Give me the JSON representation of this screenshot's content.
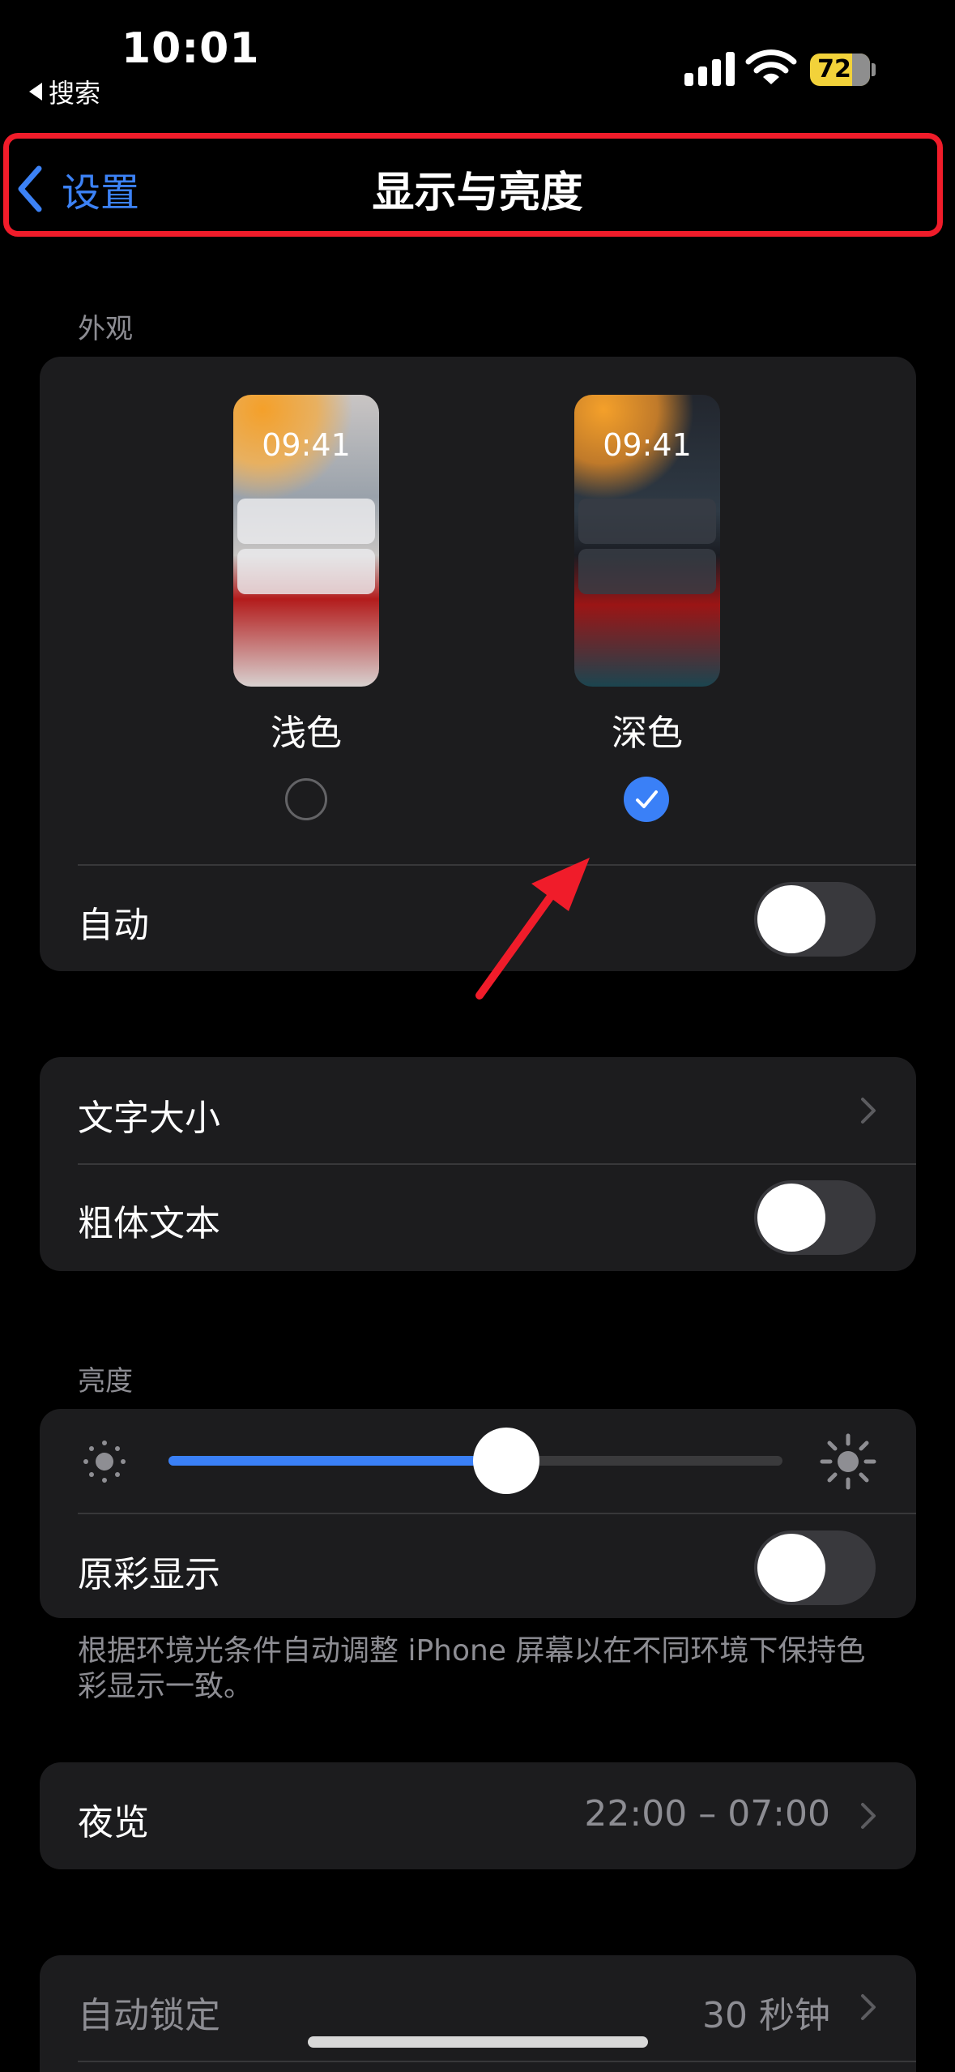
{
  "status_bar": {
    "time": "10:01",
    "back_app": "搜索",
    "battery": "72"
  },
  "nav": {
    "back_label": "设置",
    "title": "显示与亮度"
  },
  "appearance": {
    "header": "外观",
    "light": {
      "label": "浅色",
      "time": "09:41",
      "selected": false
    },
    "dark": {
      "label": "深色",
      "time": "09:41",
      "selected": true
    },
    "auto_label": "自动",
    "auto_on": false
  },
  "text": {
    "text_size_label": "文字大小",
    "bold_text_label": "粗体文本",
    "bold_on": false
  },
  "brightness": {
    "header": "亮度",
    "level": 0.55,
    "true_tone_label": "原彩显示",
    "true_tone_on": false,
    "footnote": "根据环境光条件自动调整 iPhone 屏幕以在不同环境下保持色彩显示一致。"
  },
  "night_shift": {
    "label": "夜览",
    "value": "22:00 – 07:00"
  },
  "auto_lock": {
    "label": "自动锁定",
    "value": "30 秒钟"
  },
  "colors": {
    "accent": "#3a80f7",
    "annotation": "#f01c2a",
    "battery": "#f2d23a"
  }
}
